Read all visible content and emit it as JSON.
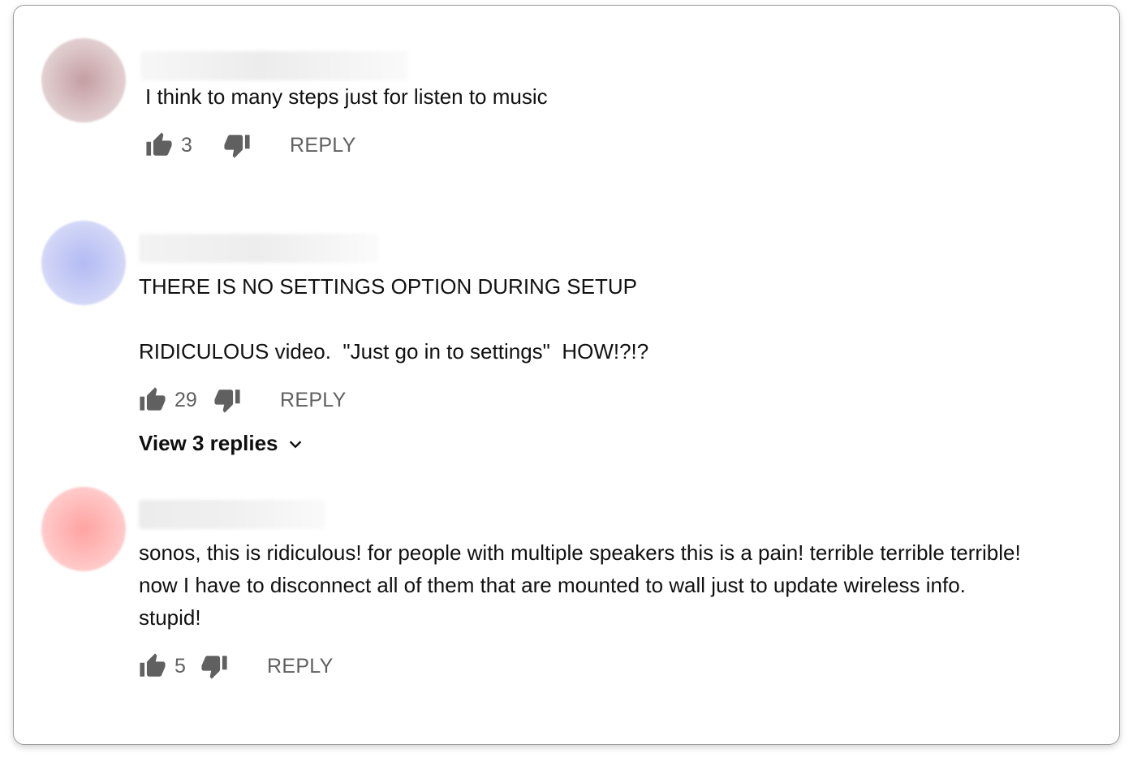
{
  "comments": [
    {
      "text": "I think to many steps just for listen to music",
      "likes": "3",
      "reply_label": "REPLY",
      "avatar_color": "#c9a6aa"
    },
    {
      "text": "THERE IS NO SETTINGS OPTION DURING SETUP\n\nRIDICULOUS video.  \"Just go in to settings\"  HOW!?!?",
      "likes": "29",
      "reply_label": "REPLY",
      "view_replies_label": "View 3 replies",
      "avatar_color": "#b7bff2"
    },
    {
      "text": "sonos, this is ridiculous! for people with multiple speakers this is a pain! terrible terrible terrible! now I have to disconnect all of them that are mounted to wall just to update wireless info.  stupid!",
      "likes": "5",
      "reply_label": "REPLY",
      "avatar_color": "#ffadab"
    }
  ],
  "icons": {
    "like": "thumb-up-icon",
    "dislike": "thumb-down-icon",
    "expand": "chevron-down-icon"
  },
  "colors": {
    "action_gray": "#606060",
    "text": "#111111",
    "card_border": "#9e9e9e"
  }
}
